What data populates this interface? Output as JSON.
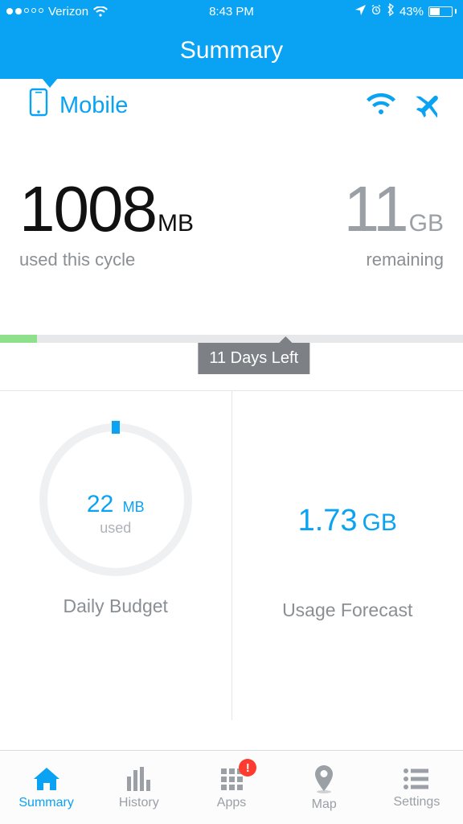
{
  "status": {
    "carrier": "Verizon",
    "time": "8:43 PM",
    "battery_pct": "43%"
  },
  "header": {
    "title": "Summary"
  },
  "source": {
    "mobile_label": "Mobile"
  },
  "usage": {
    "used_value": "1008",
    "used_unit": "MB",
    "used_caption": "used this cycle",
    "remaining_value": "11",
    "remaining_unit": "GB",
    "remaining_caption": "remaining"
  },
  "progress": {
    "pill": "11 Days Left",
    "fill_pct": 8
  },
  "daily": {
    "value": "22",
    "unit": "MB",
    "used_label": "used",
    "title": "Daily Budget"
  },
  "forecast": {
    "value": "1.73",
    "unit": "GB",
    "title": "Usage Forecast"
  },
  "tabs": {
    "summary": "Summary",
    "history": "History",
    "apps": "Apps",
    "map": "Map",
    "settings": "Settings",
    "apps_badge": "!"
  }
}
